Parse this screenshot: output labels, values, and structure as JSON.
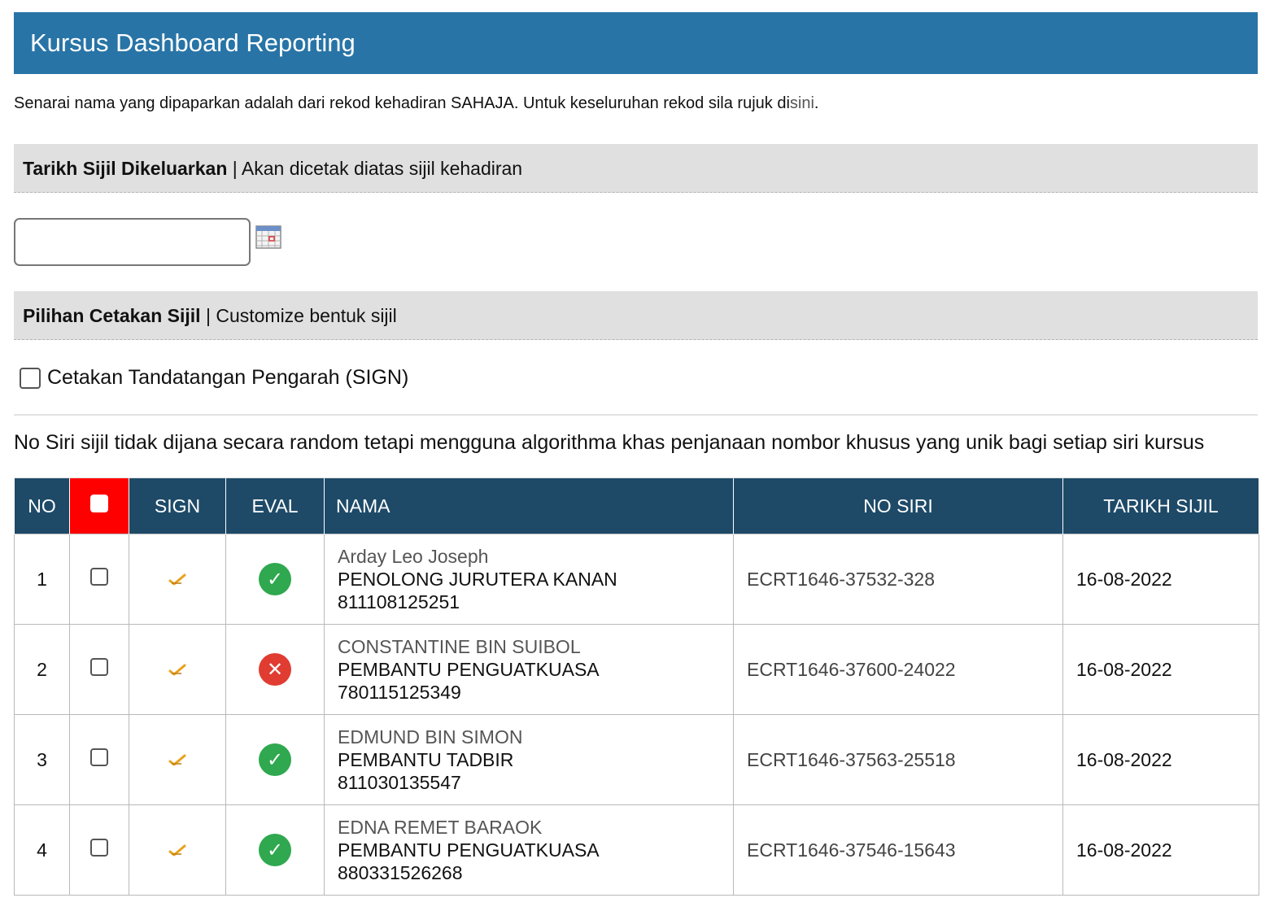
{
  "header": {
    "title": "Kursus Dashboard Reporting"
  },
  "notice": {
    "text": "Senarai nama yang dipaparkan adalah dari rekod kehadiran SAHAJA. Untuk keseluruhan rekod sila rujuk di",
    "link": "sini",
    "suffix": "."
  },
  "date_section": {
    "bold": "Tarikh Sijil Dikeluarkan",
    "rest": " | Akan dicetak diatas sijil kehadiran",
    "input_value": ""
  },
  "print_section": {
    "bold": "Pilihan Cetakan Sijil",
    "rest": " | Customize bentuk sijil",
    "sign_option_label": "Cetakan Tandatangan Pengarah (SIGN)"
  },
  "serial_note": "No Siri sijil tidak dijana secara random tetapi mengguna algorithma khas penjanaan nombor khusus yang unik bagi setiap siri kursus",
  "table": {
    "columns": {
      "no": "NO",
      "sign": "SIGN",
      "eval": "EVAL",
      "nama": "NAMA",
      "no_siri": "NO SIRI",
      "tarikh": "TARIKH SIJIL"
    },
    "rows": [
      {
        "no": "1",
        "name": "Arday Leo Joseph",
        "position": "PENOLONG JURUTERA KANAN",
        "ic": "811108125251",
        "eval": "pass",
        "no_siri": "ECRT1646-37532-328",
        "tarikh": "16-08-2022"
      },
      {
        "no": "2",
        "name": "CONSTANTINE BIN SUIBOL",
        "position": "PEMBANTU PENGUATKUASA",
        "ic": "780115125349",
        "eval": "fail",
        "no_siri": "ECRT1646-37600-24022",
        "tarikh": "16-08-2022"
      },
      {
        "no": "3",
        "name": "EDMUND BIN SIMON",
        "position": "PEMBANTU TADBIR",
        "ic": "811030135547",
        "eval": "pass",
        "no_siri": "ECRT1646-37563-25518",
        "tarikh": "16-08-2022"
      },
      {
        "no": "4",
        "name": "EDNA REMET BARAOK",
        "position": "PEMBANTU PENGUATKUASA",
        "ic": "880331526268",
        "eval": "pass",
        "no_siri": "ECRT1646-37546-15643",
        "tarikh": "16-08-2022"
      }
    ]
  },
  "colors": {
    "title_bar": "#2874a6",
    "table_header": "#1e4a68",
    "select_all_header": "#ff0000",
    "eval_pass": "#2fa84f",
    "eval_fail": "#e03c31"
  },
  "icons": {
    "calendar": "calendar-icon",
    "sign": "signature-check-icon",
    "eval_pass": "check-circle-icon",
    "eval_fail": "x-circle-icon"
  }
}
